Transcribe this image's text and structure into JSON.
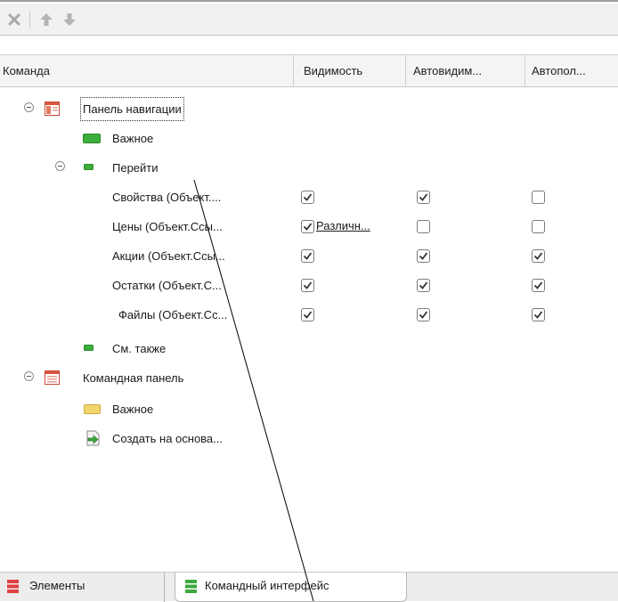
{
  "toolbar": {
    "buttons": [
      {
        "name": "delete-button",
        "icon": "close-icon"
      },
      {
        "name": "move-up-button",
        "icon": "arrow-up-icon"
      },
      {
        "name": "move-down-button",
        "icon": "arrow-down-icon"
      }
    ]
  },
  "columns": {
    "command": "Команда",
    "visibility": "Видимость",
    "autovisibility": "Автовидим...",
    "autoposition": "Автопол..."
  },
  "tree": {
    "nav_panel": "Панель навигации",
    "nav_important": "Важное",
    "nav_goto": "Перейти",
    "items": [
      {
        "label": "Свойства (Объект....",
        "visibility": true,
        "visibility_text": "",
        "autovisibility": true,
        "autoposition": false
      },
      {
        "label": "Цены (Объект.Ссы...",
        "visibility": true,
        "visibility_text": "Различн...",
        "autovisibility": false,
        "autoposition": false
      },
      {
        "label": "Акции (Объект.Ссы...",
        "visibility": true,
        "visibility_text": "",
        "autovisibility": true,
        "autoposition": true
      },
      {
        "label": "Остатки (Объект.С...",
        "visibility": true,
        "visibility_text": "",
        "autovisibility": true,
        "autoposition": true
      },
      {
        "label": "Файлы (Объект.Сс...",
        "visibility": true,
        "visibility_text": "",
        "autovisibility": true,
        "autoposition": true
      }
    ],
    "see_also": "См. также",
    "cmd_panel": "Командная панель",
    "cmd_important": "Важное",
    "create_based": "Создать на основа..."
  },
  "tabs": {
    "elements": "Элементы",
    "command_interface": "Командный интерфейс"
  },
  "colors": {
    "nav_green": "#3cae3c",
    "cmd_yellow": "#f3d66b",
    "tab_red": "#e04040",
    "tab_green": "#3aa83a"
  }
}
